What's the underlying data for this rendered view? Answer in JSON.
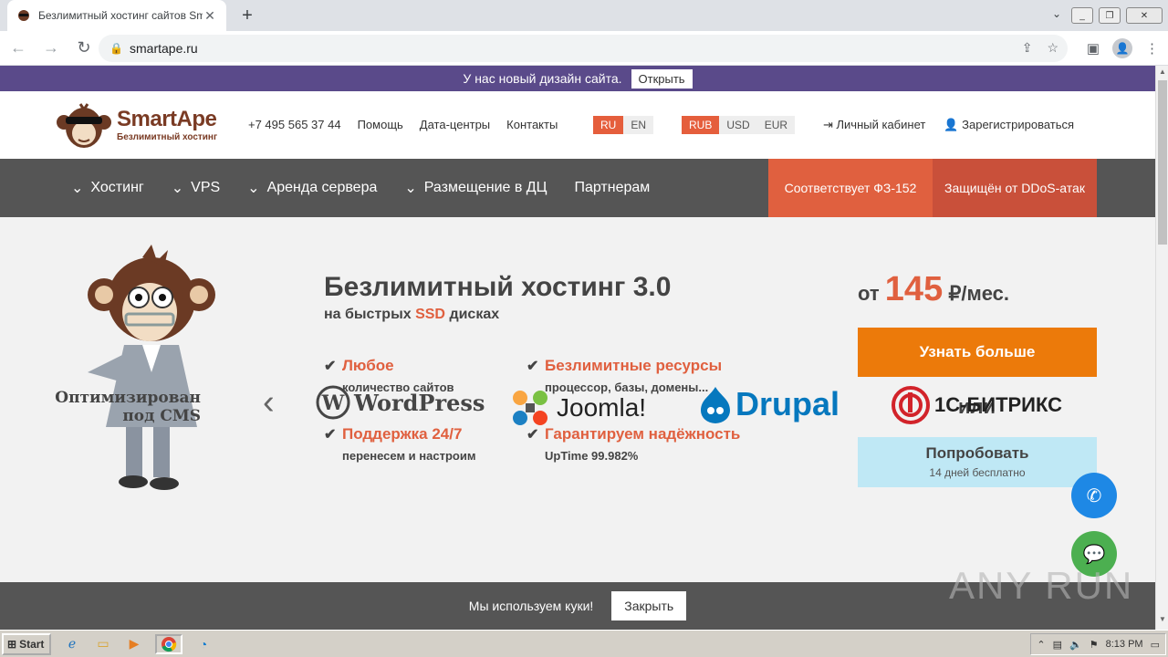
{
  "browser": {
    "tab_title": "Безлимитный хостинг сайтов Smar",
    "url": "smartape.ru"
  },
  "notice": {
    "text": "У нас новый дизайн сайта.",
    "button": "Открыть"
  },
  "header": {
    "brand": "SmartApe",
    "tagline": "Безлимитный хостинг",
    "links": [
      "+7 495 565 37 44",
      "Помощь",
      "Дата-центры",
      "Контакты"
    ],
    "languages": [
      "RU",
      "EN"
    ],
    "currencies": [
      "RUB",
      "USD",
      "EUR"
    ],
    "account": "Личный кабинет",
    "register": "Зарегистрироваться"
  },
  "nav": {
    "items": [
      "Хостинг",
      "VPS",
      "Аренда сервера",
      "Размещение в ДЦ",
      "Партнерам"
    ],
    "badge1": "Соответствует ФЗ-152",
    "badge2": "Защищён от DDoS-атак"
  },
  "hero": {
    "title": "Безлимитный хостинг 3.0",
    "subtitle_pre": "на быстрых",
    "subtitle_accent": "SSD",
    "subtitle_post": "дисках",
    "features": [
      {
        "title": "Любое",
        "sub": "количество сайтов"
      },
      {
        "title": "Безлимитные ресурсы",
        "sub": "процессор, базы, домены..."
      },
      {
        "title": "Поддержка 24/7",
        "sub": "перенесем и настроим"
      },
      {
        "title": "Гарантируем надёжность",
        "sub": "UpTime 99.982%"
      }
    ],
    "price_from": "от",
    "price": "145",
    "price_unit": "₽/мес.",
    "learn_more": "Узнать больше",
    "or": "или",
    "try": "Попробовать",
    "try_sub": "14 дней бесплатно"
  },
  "cms": {
    "label1": "Оптимизирован",
    "label2": "под CMS",
    "logos": [
      "WordPress",
      "Joomla!",
      "Drupal",
      "1С-БИТРИКС"
    ]
  },
  "cookie": {
    "text": "Мы используем куки!",
    "button": "Закрыть"
  },
  "watermark": "ANY RUN",
  "taskbar": {
    "start": "Start",
    "time": "8:13 PM"
  },
  "colors": {
    "accent": "#e0603f",
    "nav": "#555555",
    "notice": "#5a4a8a",
    "cta": "#ec7a0a"
  }
}
